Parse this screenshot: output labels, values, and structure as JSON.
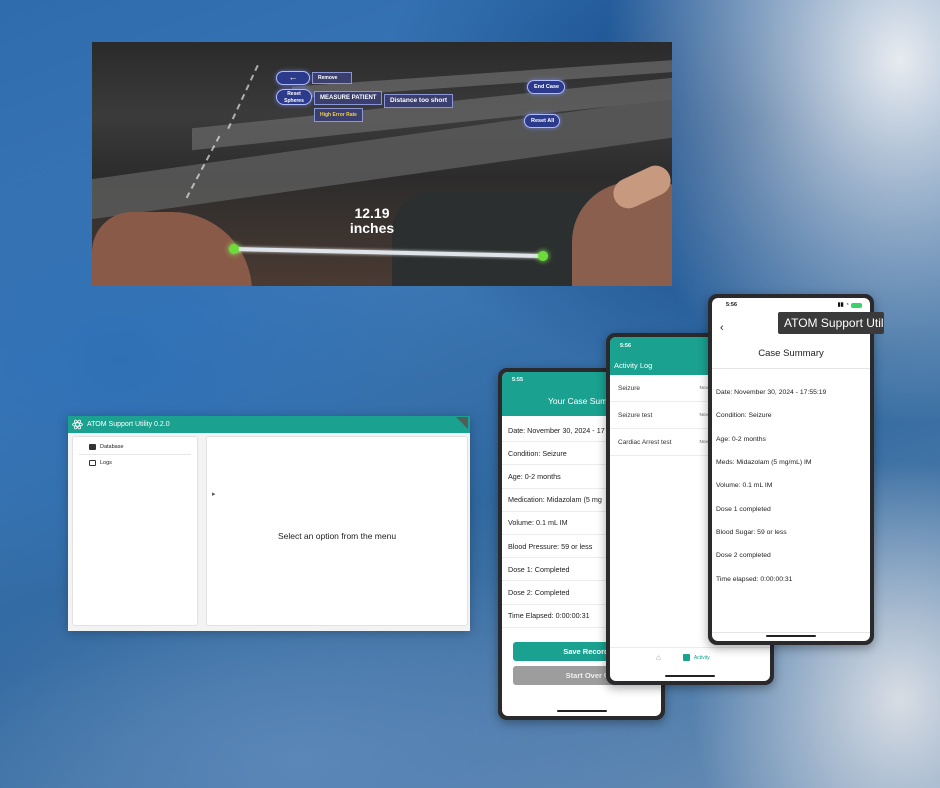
{
  "vr": {
    "measurement_value": "12.19",
    "measurement_unit": "inches",
    "buttons": {
      "back": "←",
      "remove": "Remove",
      "reset_spheres": "Reset Spheres",
      "measure_patient": "MEASURE PATIENT",
      "distance_status": "Distance too short",
      "error_rate": "High Error Rate",
      "end_case": "End Case",
      "reset_all": "Reset All"
    }
  },
  "desktop": {
    "title": "ATOM Support Utility 0.2.0",
    "sidebar": [
      {
        "label": "Database",
        "icon": "database-icon"
      },
      {
        "label": "Logs",
        "icon": "logs-icon"
      }
    ],
    "placeholder": "Select an option from the menu"
  },
  "phone_summary": {
    "time": "5:55",
    "title": "Your Case Summ",
    "rows": [
      "Date: November 30, 2024 - 17",
      "Condition: Seizure",
      "Age: 0-2 months",
      "Medication: Midazolam (5 mg",
      "Volume: 0.1 mL IM",
      "Blood Pressure: 59 or less",
      "Dose 1: Completed",
      "Dose 2: Completed",
      "Time Elapsed: 0:00:00:31"
    ],
    "save_label": "Save Records",
    "start_over_label": "Start Over ⟳"
  },
  "phone_activity": {
    "time": "5:56",
    "title": "Activity Log",
    "logs": [
      {
        "name": "Seizure",
        "date": "Nov 30,"
      },
      {
        "name": "Seizure test",
        "date": "Nov 30,"
      },
      {
        "name": "Cardiac Arrest test",
        "date": "Nov 30,"
      }
    ],
    "tab_home": "⌂",
    "tab_activity": "Activity"
  },
  "phone_case": {
    "time": "5:56",
    "back": "‹",
    "title": "Case Summary",
    "rows": [
      "Date: November 30, 2024 - 17:55:19",
      "Condition: Seizure",
      "Age: 0-2 months",
      "Meds: Midazolam (5 mg/mL) IM",
      "Volume: 0.1 mL IM",
      "Dose 1 completed",
      "Blood Sugar: 59 or less",
      "Dose 2 completed",
      "Time elapsed: 0:00:00:31"
    ]
  },
  "tooltip": "ATOM Support Utility",
  "colors": {
    "accent": "#1aa190",
    "vr_button": "#2c3a8c",
    "measure_dot": "#6bdc3a"
  }
}
